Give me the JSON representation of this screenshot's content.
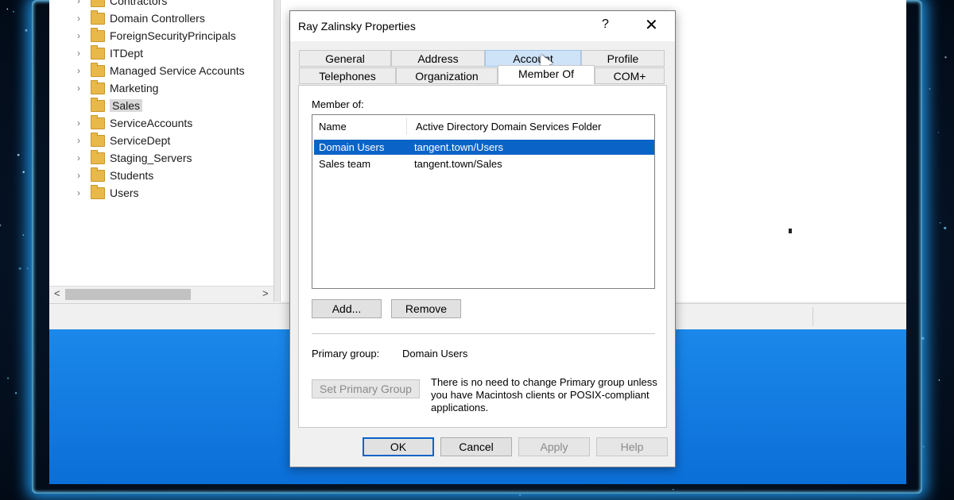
{
  "tree": {
    "items": [
      {
        "label": "Contractors",
        "has_children": true,
        "selected": false
      },
      {
        "label": "Domain Controllers",
        "has_children": true,
        "selected": false
      },
      {
        "label": "ForeignSecurityPrincipals",
        "has_children": true,
        "selected": false
      },
      {
        "label": "ITDept",
        "has_children": true,
        "selected": false
      },
      {
        "label": "Managed Service Accounts",
        "has_children": true,
        "selected": false
      },
      {
        "label": "Marketing",
        "has_children": true,
        "selected": false
      },
      {
        "label": "Sales",
        "has_children": false,
        "selected": true
      },
      {
        "label": "ServiceAccounts",
        "has_children": true,
        "selected": false
      },
      {
        "label": "ServiceDept",
        "has_children": true,
        "selected": false
      },
      {
        "label": "Staging_Servers",
        "has_children": true,
        "selected": false
      },
      {
        "label": "Students",
        "has_children": true,
        "selected": false
      },
      {
        "label": "Users",
        "has_children": true,
        "selected": false
      }
    ],
    "icons": {
      "expand": "chevron-right-icon",
      "folder": "folder-icon"
    },
    "scroll": {
      "left": "<",
      "right": ">"
    }
  },
  "dialog": {
    "title": "Ray Zalinsky Properties",
    "help": "?",
    "close": "✕",
    "tabs_row1": [
      "General",
      "Address",
      "Account",
      "Profile"
    ],
    "tabs_row2": [
      "Telephones",
      "Organization",
      "Member Of",
      "COM+"
    ],
    "active_tab": "Member Of",
    "hover_tab": "Account",
    "member_of_label": "Member of:",
    "columns": [
      "Name",
      "Active Directory Domain Services Folder"
    ],
    "rows": [
      {
        "name": "Domain Users",
        "folder": "tangent.town/Users",
        "selected": true
      },
      {
        "name": "Sales team",
        "folder": "tangent.town/Sales",
        "selected": false
      }
    ],
    "add_label": "Add...",
    "remove_label": "Remove",
    "primary_group_label": "Primary group:",
    "primary_group_value": "Domain Users",
    "set_primary_label": "Set Primary Group",
    "note": "There is no need to change Primary group unless you have Macintosh clients or POSIX-compliant applications.",
    "ok_label": "OK",
    "cancel_label": "Cancel",
    "apply_label": "Apply",
    "help_label": "Help"
  },
  "colors": {
    "selection": "#0a64c8",
    "desktop": "#1b88ea",
    "glow": "#1e8fe0"
  }
}
